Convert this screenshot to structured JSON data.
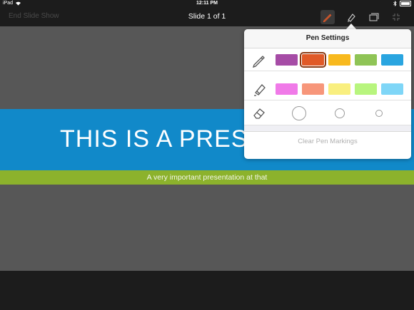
{
  "status": {
    "device": "iPad",
    "time": "12:11 PM"
  },
  "toolbar": {
    "end_show_label": "End Slide Show",
    "slide_counter": "Slide 1 of 1"
  },
  "slide": {
    "title": "THIS IS A PRESE",
    "subtitle": "A very important presentation at that"
  },
  "pen_settings": {
    "title": "Pen Settings",
    "pen_colors": [
      "#a64ca6",
      "#e05a28",
      "#f8b91e",
      "#8fc456",
      "#2aa5e0"
    ],
    "pen_selected_index": 1,
    "highlighter_colors": [
      "#f07ae8",
      "#f7967a",
      "#f9ef7f",
      "#b8f57e",
      "#7fd6f7"
    ],
    "eraser_sizes": [
      "large",
      "medium",
      "small"
    ],
    "clear_label": "Clear Pen Markings"
  },
  "icons": {
    "pen": "pen-icon",
    "highlighter": "highlighter-icon",
    "eraser": "eraser-icon",
    "wifi": "wifi-icon",
    "bluetooth": "bluetooth-icon",
    "battery": "battery-icon"
  }
}
